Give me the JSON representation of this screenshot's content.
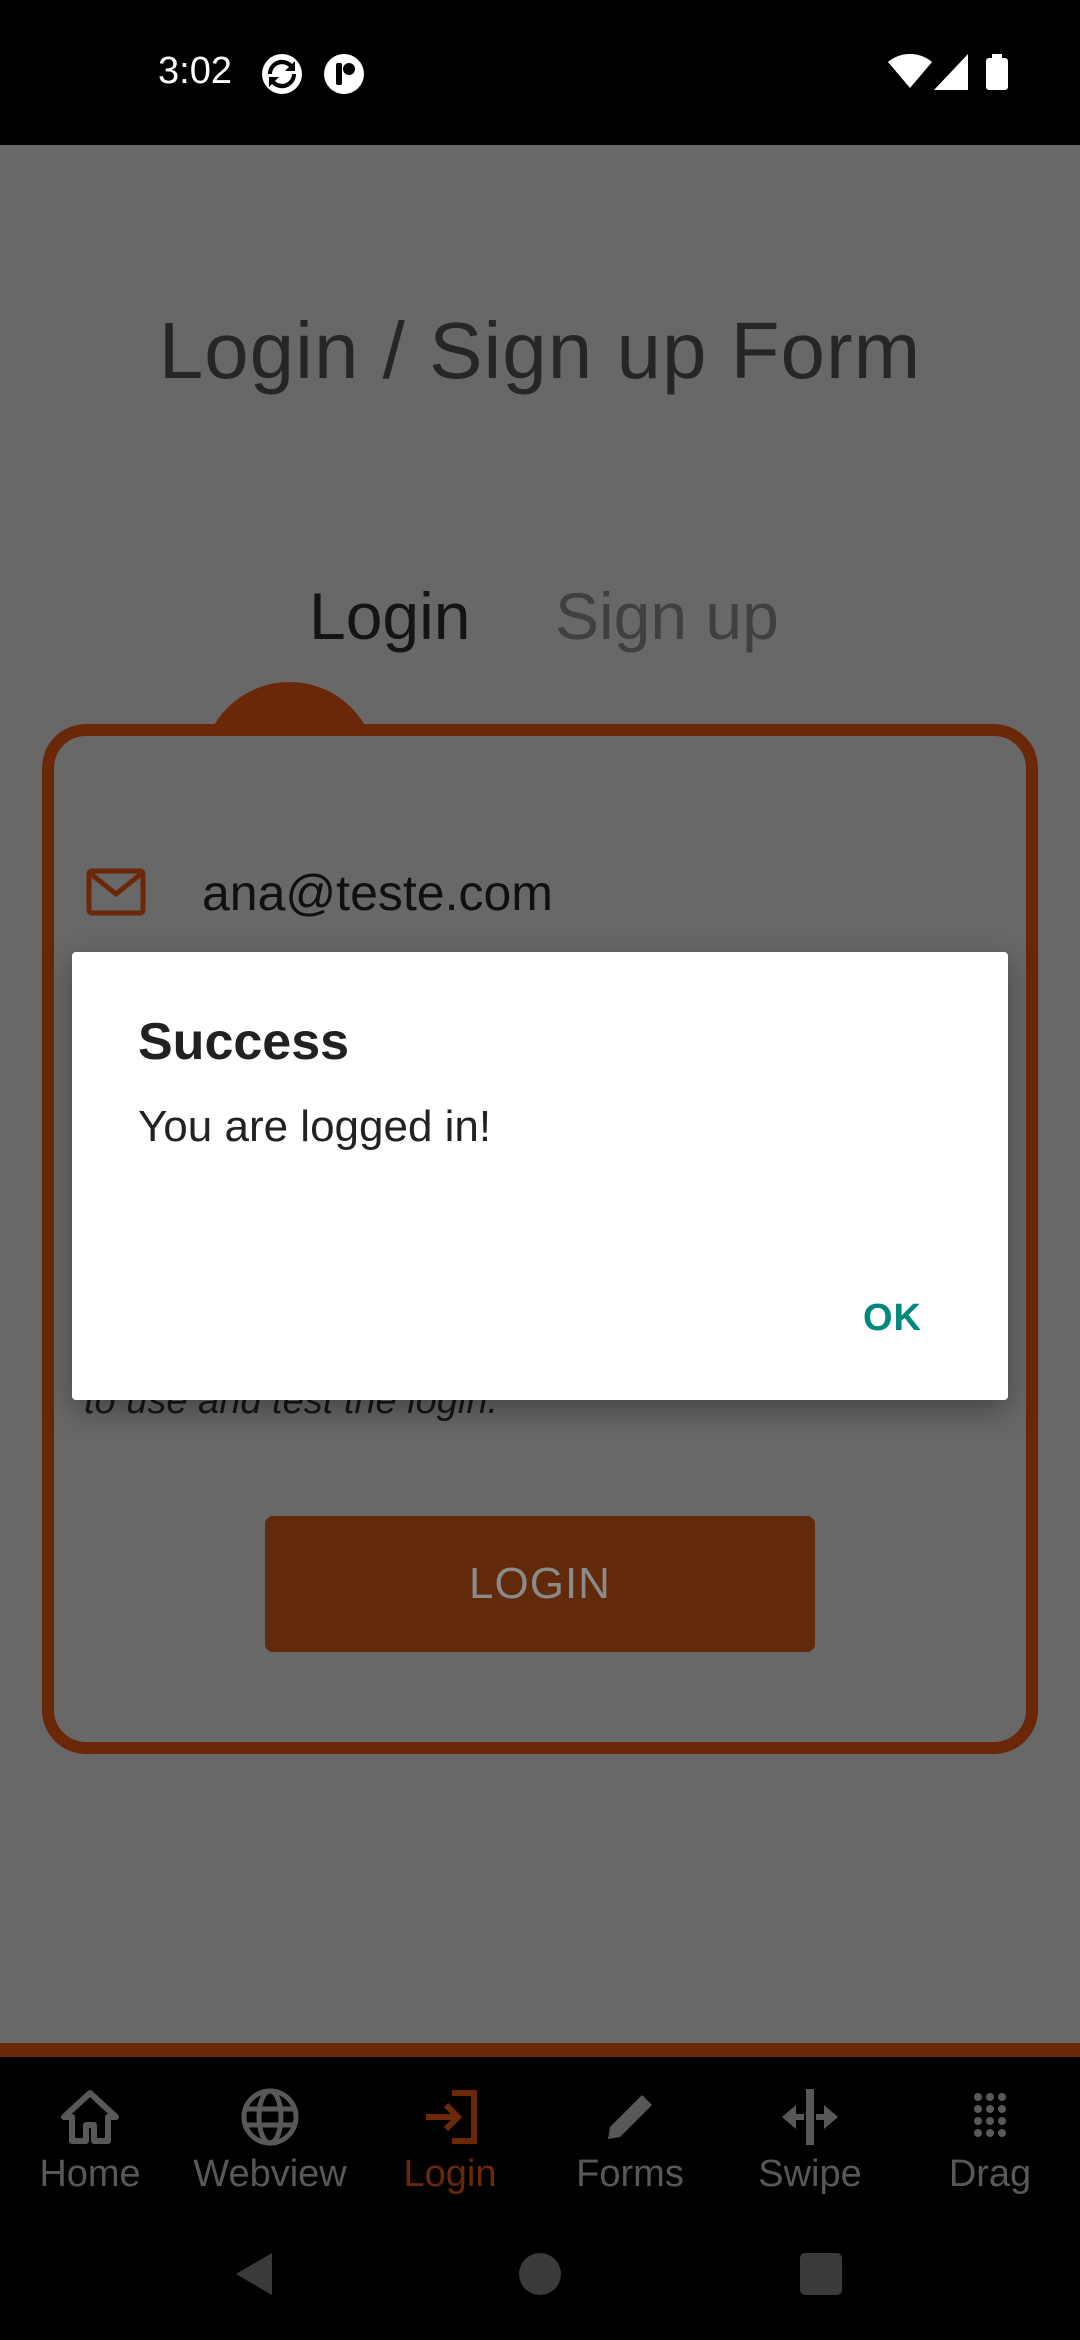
{
  "status_bar": {
    "time": "3:02"
  },
  "page": {
    "title": "Login / Sign up Form"
  },
  "tabs": [
    {
      "label": "Login"
    },
    {
      "label": "Sign up"
    }
  ],
  "form": {
    "email_value": "ana@teste.com",
    "hint_partial": "to use and test the login.",
    "login_button": "LOGIN"
  },
  "dialog": {
    "title": "Success",
    "message": "You are logged in!",
    "ok_label": "OK"
  },
  "bottom_nav": {
    "items": [
      {
        "label": "Home",
        "icon": "home-icon"
      },
      {
        "label": "Webview",
        "icon": "globe-icon"
      },
      {
        "label": "Login",
        "icon": "login-icon"
      },
      {
        "label": "Forms",
        "icon": "pencil-icon"
      },
      {
        "label": "Swipe",
        "icon": "swipe-icon"
      },
      {
        "label": "Drag",
        "icon": "grid-icon"
      }
    ],
    "active": "Login"
  },
  "colors": {
    "accent": "#6b2808",
    "dialog_button": "#00897b",
    "overlay": "#686868"
  }
}
